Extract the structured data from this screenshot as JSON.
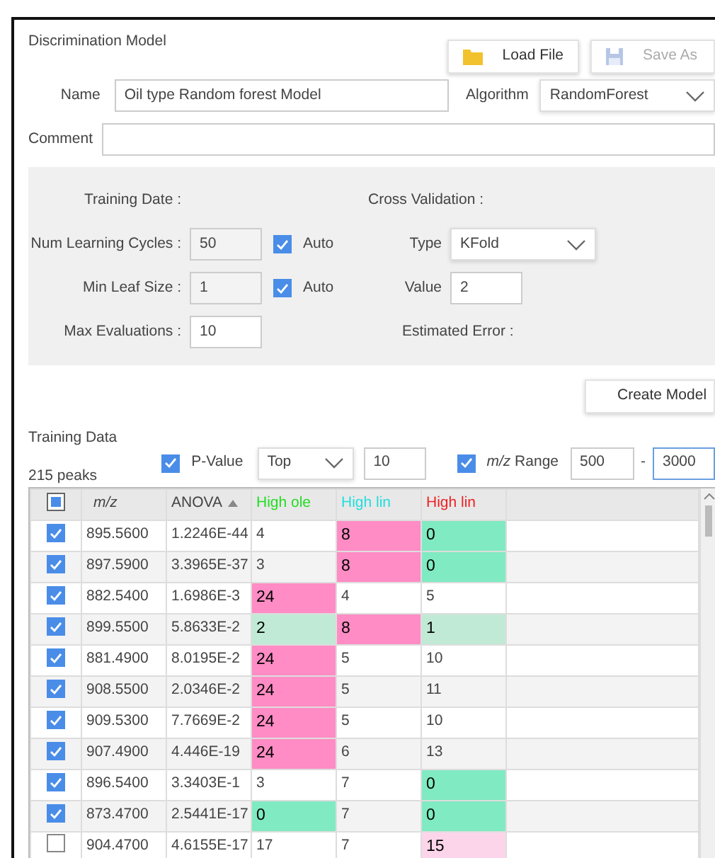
{
  "panel": {
    "title": "Discrimination Model"
  },
  "toolbar": [
    {
      "label": "Load File",
      "disabled": false
    },
    {
      "label": "Save As",
      "disabled": true
    }
  ],
  "name": {
    "label": "Name",
    "value": "Oil type Random forest Model"
  },
  "algorithm": {
    "label": "Algorithm",
    "value": "RandomForest"
  },
  "comment": {
    "label": "Comment"
  },
  "settings": {
    "left": [
      {
        "kind": "info",
        "label": "Training Date :"
      },
      {
        "kind": "input",
        "label": "Num Learning Cycles :",
        "value": "50",
        "disabled": true,
        "auto": {
          "label": "Auto",
          "checked": true
        }
      },
      {
        "kind": "input",
        "label": "Min Leaf Size :",
        "value": "1",
        "disabled": true,
        "auto": {
          "label": "Auto",
          "checked": true
        }
      },
      {
        "kind": "input",
        "label": "Max Evaluations :",
        "value": "10",
        "disabled": false
      }
    ],
    "right": [
      {
        "kind": "info",
        "label": "Cross Validation :"
      },
      {
        "kind": "select",
        "label": "Type",
        "value": "KFold"
      },
      {
        "kind": "input",
        "label": "Value",
        "value": "2",
        "disabled": false
      },
      {
        "kind": "info",
        "label": "Estimated Error :"
      }
    ]
  },
  "create_button": {
    "label": "Create Model"
  },
  "training": {
    "title": "Training Data",
    "count": "215 peaks",
    "pvalue": {
      "label": "P-Value",
      "checked": true
    },
    "mode": {
      "value": "Top"
    },
    "top_n": {
      "value": "10"
    },
    "range": {
      "label": "*m/z* Range",
      "checked": true
    },
    "range_min": {
      "value": "500"
    },
    "range_sep": "-",
    "range_max": {
      "value": "3000"
    }
  },
  "table": {
    "header_checkbox": {
      "indeterminate": true
    },
    "columns": [
      {
        "label": "m/z",
        "italic": true
      },
      {
        "label": "ANOVA",
        "sorted": true
      },
      {
        "label": "High ole",
        "color": "#22dd22"
      },
      {
        "label": "High lin",
        "color": "#22dddd"
      },
      {
        "label": "High lin",
        "color": "#ee2222"
      }
    ],
    "rows": [
      {
        "checked": true,
        "cells": [
          {
            "text": "895.5600"
          },
          {
            "text": "1.2246E-44"
          },
          {
            "text": "4"
          },
          {
            "text": "8",
            "color": "#ff8cc4"
          },
          {
            "text": "0",
            "color": "#80eac2"
          }
        ]
      },
      {
        "checked": true,
        "cells": [
          {
            "text": "897.5900"
          },
          {
            "text": "3.3965E-37"
          },
          {
            "text": "3"
          },
          {
            "text": "8",
            "color": "#ff8cc4"
          },
          {
            "text": "0",
            "color": "#80eac2"
          }
        ]
      },
      {
        "checked": true,
        "cells": [
          {
            "text": "882.5400"
          },
          {
            "text": "1.6986E-3"
          },
          {
            "text": "24",
            "color": "#ff8cc4"
          },
          {
            "text": "4"
          },
          {
            "text": "5"
          }
        ]
      },
      {
        "checked": true,
        "cells": [
          {
            "text": "899.5500"
          },
          {
            "text": "5.8633E-2"
          },
          {
            "text": "2",
            "color": "#c0ead5"
          },
          {
            "text": "8",
            "color": "#ff8cc4"
          },
          {
            "text": "1",
            "color": "#c0ead5"
          }
        ]
      },
      {
        "checked": true,
        "cells": [
          {
            "text": "881.4900"
          },
          {
            "text": "8.0195E-2"
          },
          {
            "text": "24",
            "color": "#ff8cc4"
          },
          {
            "text": "5"
          },
          {
            "text": "10"
          }
        ]
      },
      {
        "checked": true,
        "cells": [
          {
            "text": "908.5500"
          },
          {
            "text": "2.0346E-2"
          },
          {
            "text": "24",
            "color": "#ff8cc4"
          },
          {
            "text": "5"
          },
          {
            "text": "11"
          }
        ]
      },
      {
        "checked": true,
        "cells": [
          {
            "text": "909.5300"
          },
          {
            "text": "7.7669E-2"
          },
          {
            "text": "24",
            "color": "#ff8cc4"
          },
          {
            "text": "5"
          },
          {
            "text": "10"
          }
        ]
      },
      {
        "checked": true,
        "cells": [
          {
            "text": "907.4900"
          },
          {
            "text": "4.446E-19"
          },
          {
            "text": "24",
            "color": "#ff8cc4"
          },
          {
            "text": "6"
          },
          {
            "text": "13"
          }
        ]
      },
      {
        "checked": true,
        "cells": [
          {
            "text": "896.5400"
          },
          {
            "text": "3.3403E-1"
          },
          {
            "text": "3"
          },
          {
            "text": "7"
          },
          {
            "text": "0",
            "color": "#80eac2"
          }
        ]
      },
      {
        "checked": true,
        "cells": [
          {
            "text": "873.4700"
          },
          {
            "text": "2.5441E-17"
          },
          {
            "text": "0",
            "color": "#80eac2"
          },
          {
            "text": "7"
          },
          {
            "text": "0",
            "color": "#80eac2"
          }
        ]
      },
      {
        "checked": false,
        "cells": [
          {
            "text": "904.4700"
          },
          {
            "text": "4.6155E-17"
          },
          {
            "text": "17"
          },
          {
            "text": "7"
          },
          {
            "text": "15",
            "color": "#fdd5ea"
          }
        ]
      }
    ]
  }
}
